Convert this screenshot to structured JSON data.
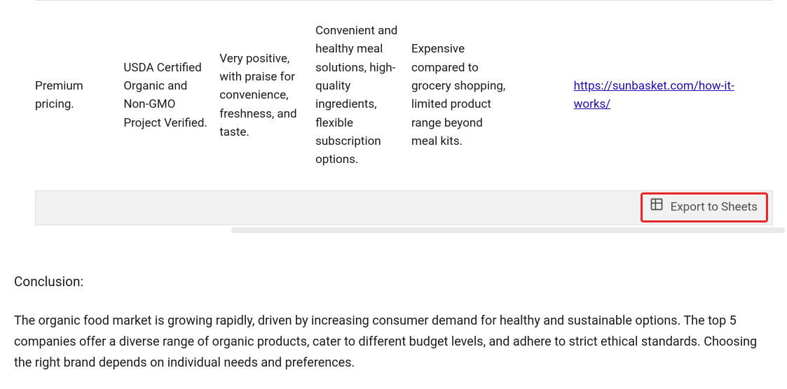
{
  "table": {
    "rows": [
      {
        "pricing": "Premium pricing.",
        "certifications": "USDA Certified Organic and Non-GMO Project Verified.",
        "reviews": "Very positive, with praise for convenience, freshness, and taste.",
        "strengths": "Convenient and healthy meal solutions, high-quality ingredients, flexible subscription options.",
        "weaknesses": "Expensive compared to grocery shopping, limited product range beyond meal kits.",
        "source_url": "https://sunbasket.com/how-it-works/"
      }
    ]
  },
  "export": {
    "label": "Export to Sheets"
  },
  "conclusion": {
    "heading": "Conclusion:",
    "body": "The organic food market is growing rapidly, driven by increasing consumer demand for healthy and sustainable options. The top 5 companies offer a diverse range of organic products, cater to different budget levels, and adhere to strict ethical standards. Choosing the right brand depends on individual needs and preferences."
  }
}
